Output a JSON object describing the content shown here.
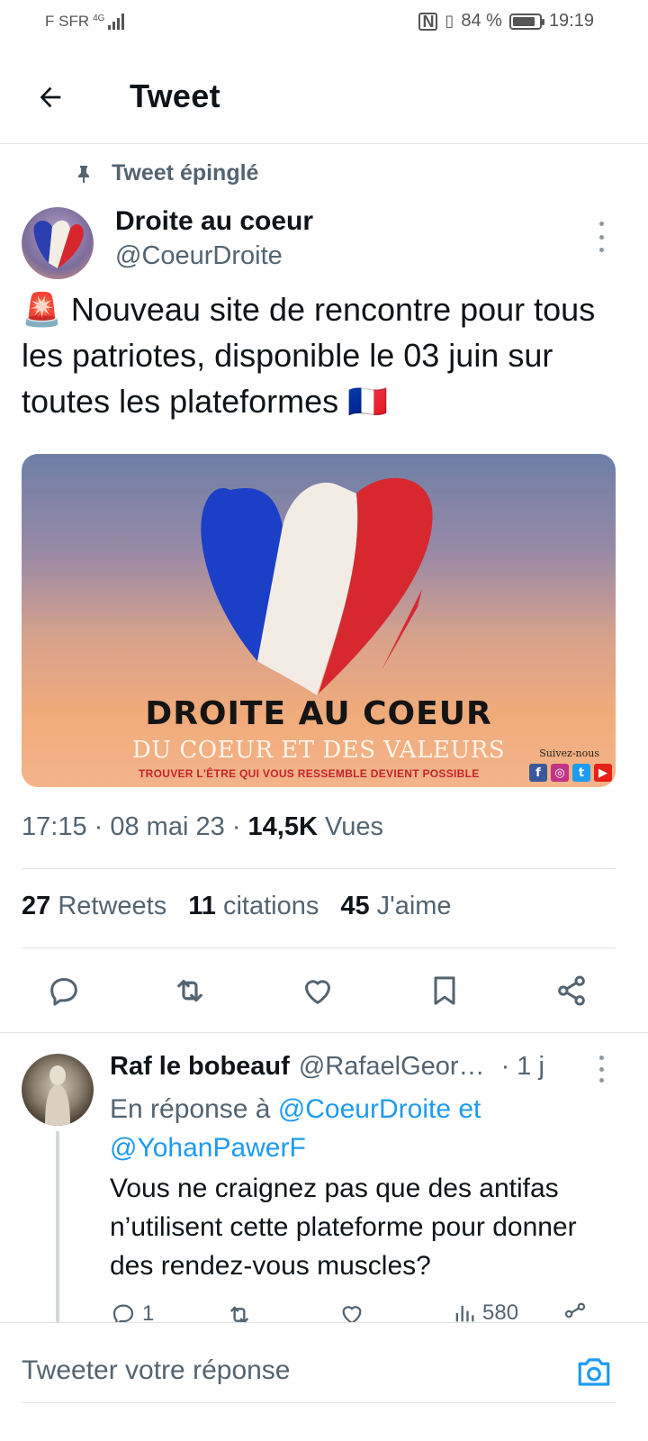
{
  "status_bar": {
    "carrier": "F SFR",
    "network": "4G",
    "battery_percent": "84 %",
    "time": "19:19"
  },
  "header": {
    "title": "Tweet",
    "back_icon": "arrow-left-icon"
  },
  "tweet": {
    "pinned_label": "Tweet épinglé",
    "author_name": "Droite au coeur",
    "author_handle": "@CoeurDroite",
    "text": "🚨 Nouveau site de rencontre pour tous les patriotes, disponible le 03 juin sur toutes les plateformes 🇫🇷",
    "media": {
      "title": "DROITE AU COEUR",
      "subtitle": "DU COEUR ET DES VALEURS",
      "tagline": "TROUVER L'ÊTRE QUI VOUS RESSEMBLE DEVIENT POSSIBLE",
      "follow_label": "Suivez-nous",
      "socials": [
        "f",
        "◎",
        "t",
        "▶"
      ]
    },
    "time": "17:15",
    "date": "08 mai 23",
    "views_count": "14,5K",
    "views_label": "Vues",
    "retweets_count": "27",
    "retweets_label": "Retweets",
    "quotes_count": "11",
    "quotes_label": "citations",
    "likes_count": "45",
    "likes_label": "J'aime"
  },
  "reply": {
    "author_name": "Raf le bobeauf",
    "author_handle": "@RafaelGeor…",
    "time": "· 1 j",
    "reply_to_prefix": "En réponse à",
    "reply_to_user1": "@CoeurDroite",
    "reply_to_and": "et",
    "reply_to_user2": "@YohanPawerF",
    "text": "Vous ne craignez pas que des antifas n’utilisent cette plateforme pour donner des rendez-vous muscles?",
    "reply_count": "1",
    "views_count": "580"
  },
  "compose": {
    "placeholder": "Tweeter votre réponse"
  },
  "colors": {
    "accent": "#1d9bf0",
    "secondary_text": "#536471",
    "primary_text": "#0f1419"
  }
}
